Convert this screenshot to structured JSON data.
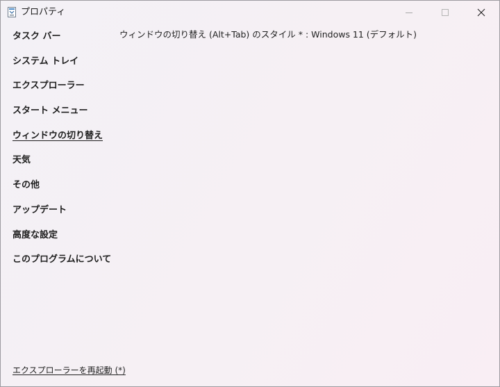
{
  "window": {
    "title": "プロパティ",
    "icon": "app-icon"
  },
  "controls": {
    "minimize_icon": "minimize-icon",
    "maximize_icon": "maximize-icon",
    "close_icon": "close-icon"
  },
  "sidebar": {
    "items": [
      {
        "label": "タスク バー"
      },
      {
        "label": "システム トレイ"
      },
      {
        "label": "エクスプローラー"
      },
      {
        "label": "スタート メニュー"
      },
      {
        "label": "ウィンドウの切り替え",
        "active": true
      },
      {
        "label": "天気"
      },
      {
        "label": "その他"
      },
      {
        "label": "アップデート"
      },
      {
        "label": "高度な設定"
      },
      {
        "label": "このプログラムについて"
      }
    ]
  },
  "main": {
    "setting_label": "ウィンドウの切り替え (Alt+Tab) のスタイル *",
    "separator": " : ",
    "setting_value": "Windows 11 (デフォルト)"
  },
  "footer": {
    "restart_link": "エクスプローラーを再起動 (*)"
  }
}
